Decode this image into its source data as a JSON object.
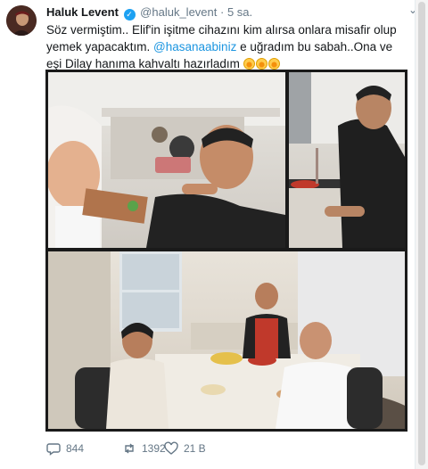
{
  "tweet": {
    "author_name": "Haluk Levent",
    "verified_glyph": "✓",
    "handle": "@haluk_levent",
    "separator": "·",
    "time": "5 sa.",
    "caret": "⌄",
    "text_part1": "Söz vermiştim.. Elif'in işitme cihazını kim alırsa onlara misafir olup yemek yapacaktım. ",
    "mention": "@hasanaabiniz",
    "text_part2": " e uğradım bu  sabah..Ona ve eşi Dilay hanıma kahvaltı hazırladım ",
    "emoji_count": 3
  },
  "actions": {
    "reply_count": "844",
    "retweet_count": "1392",
    "like_count": "21 B"
  },
  "icons": {
    "reply": "reply-icon",
    "retweet": "retweet-icon",
    "like": "like-icon",
    "verified": "verified-badge-icon"
  },
  "colors": {
    "link": "#1b95e0",
    "verified": "#1da1f2",
    "muted": "#657786"
  }
}
